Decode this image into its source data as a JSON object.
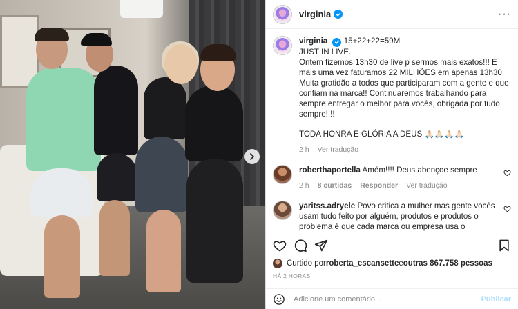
{
  "post": {
    "username": "virginia",
    "caption_user": "virginia",
    "caption_header": "15+22+22=59M",
    "caption_lines": [
      "JUST IN LIVE.",
      "Ontem fizemos 13h30 de live p sermos mais exatos!!! E mais uma vez faturamos 22 MILHÕES em apenas 13h30. Muita gratidão a todos que participaram com a gente e que confiam na marca!! Continuaremos trabalhando para sempre entregar o melhor para vocês, obrigada por tudo sempre!!!!",
      "TODA HONRA E GLÓRIA A DEUS 🙏🏻🙏🏻🙏🏻🙏🏻"
    ],
    "caption_time": "2 h",
    "caption_translate": "Ver tradução"
  },
  "comments": [
    {
      "user": "roberthaportella",
      "text": "Amém!!!! Deus abençoe sempre",
      "time": "2 h",
      "likes": "8 curtidas",
      "reply": "Responder",
      "translate": "Ver tradução"
    },
    {
      "user": "yaritss.adryele",
      "text": "Povo critica a mulher mas gente vocês usam tudo feito por alguém, produtos e produtos o problema é que cada marca ou empresa usa o marketing que pode uai. então quer dizer que se o dono da fábrica de papel higiênico fizer uma live fazendo promoção e o povo comprar está errado?"
    }
  ],
  "liked_by": {
    "prefix": "Curtido por ",
    "user": "roberta_escansette",
    "middle": " e ",
    "others": "outras 867.758 pessoas"
  },
  "time_ago": "HÁ 2 HORAS",
  "add_comment": {
    "placeholder": "Adicione um comentário...",
    "post_label": "Publicar"
  },
  "icons": {
    "header_more": "more-options-icon",
    "next": "chevron-right-icon",
    "like": "heart-icon",
    "comment": "comment-icon",
    "share": "share-icon",
    "save": "bookmark-icon",
    "emoji": "emoji-icon"
  },
  "colors": {
    "accent": "#0095f6",
    "post_disabled": "#b2dffc",
    "muted": "#8e8e8e"
  }
}
